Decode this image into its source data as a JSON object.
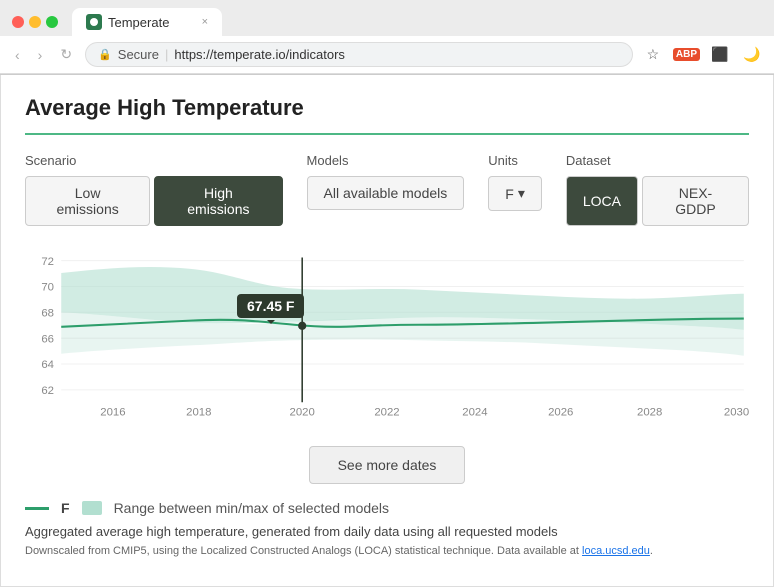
{
  "browser": {
    "tab_title": "Temperate",
    "tab_close": "×",
    "url_secure": "Secure",
    "url_full": "https://temperate.io/indicators",
    "url_domain": "temperate.io",
    "url_path": "/indicators",
    "nav_back": "‹",
    "nav_forward": "›",
    "nav_refresh": "↻"
  },
  "page": {
    "title": "Average High Temperature"
  },
  "controls": {
    "scenario_label": "Scenario",
    "models_label": "Models",
    "units_label": "Units",
    "dataset_label": "Dataset",
    "btn_low_emissions": "Low emissions",
    "btn_high_emissions": "High emissions",
    "btn_all_models": "All available models",
    "btn_units": "F",
    "btn_loca": "LOCA",
    "btn_nexgddp": "NEX-GDDP"
  },
  "chart": {
    "tooltip_value": "67.45 F",
    "y_labels": [
      "72",
      "70",
      "68",
      "66",
      "64",
      "62"
    ],
    "x_labels": [
      "2016",
      "2018",
      "2020",
      "2022",
      "2024",
      "2026",
      "2028",
      "2030"
    ]
  },
  "legend": {
    "line_label": "F",
    "range_label": "Range between min/max of selected models"
  },
  "description": "Aggregated average high temperature, generated from daily data using all requested models",
  "footnote_text": "Downscaled from CMIP5, using the Localized Constructed Analogs (LOCA) statistical technique. Data available at",
  "footnote_link": "loca.ucsd.edu",
  "see_more_label": "See more dates"
}
